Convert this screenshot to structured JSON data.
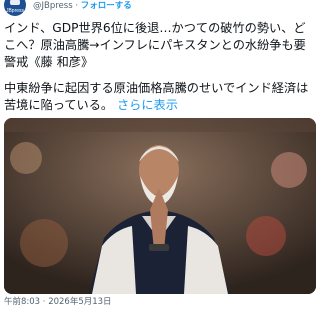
{
  "account": {
    "avatar_text": "JBpress",
    "handle": "@JBpress",
    "separator": "·",
    "follow_label": "フォローする"
  },
  "tweet": {
    "text_line1": "インド、GDP世界6位に後退…かつての破竹の勢い、どこへ？原油高騰→インフレにパキスタンとの水紛争も要警戒《藤 和彦》",
    "text_para2": "中東紛争に起因する原油価格高騰のせいでインド経済は苦境に陥っている。",
    "show_more": "さらに表示",
    "timestamp": "午前8:03 · 2026年5月13日"
  },
  "colors": {
    "link": "#1d9bf0",
    "muted": "#536471",
    "text": "#0f1419"
  },
  "icons": [
    "jbpress-logo-icon"
  ]
}
